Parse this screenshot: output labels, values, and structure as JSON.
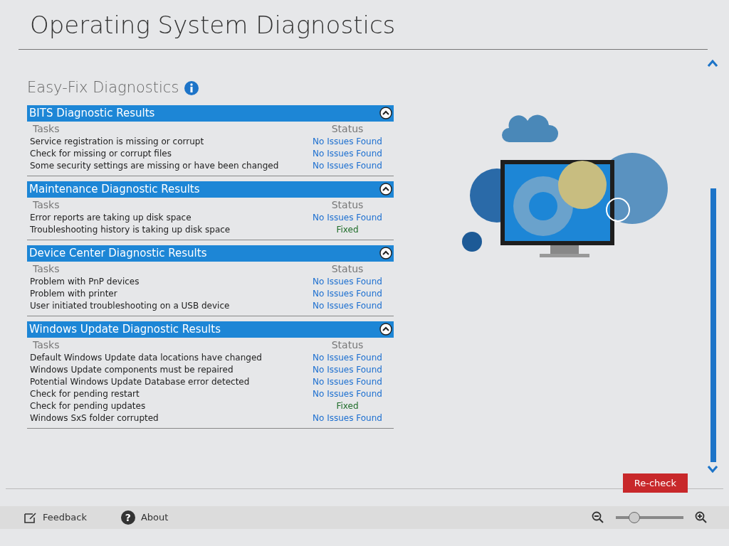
{
  "window": {
    "title": "Operating System Diagnostics"
  },
  "heading": "Easy-Fix Diagnostics",
  "sections": [
    {
      "title": "BITS Diagnostic Results",
      "expanded": true,
      "tasks_label": "Tasks",
      "status_label": "Status",
      "rows": [
        {
          "task": "Service registration is missing or corrupt",
          "status": "No Issues Found",
          "kind": "ok"
        },
        {
          "task": "Check for missing or corrupt files",
          "status": "No Issues Found",
          "kind": "ok"
        },
        {
          "task": "Some security settings are missing or have been changed",
          "status": "No Issues Found",
          "kind": "ok"
        }
      ]
    },
    {
      "title": "Maintenance Diagnostic Results",
      "expanded": true,
      "tasks_label": "Tasks",
      "status_label": "Status",
      "rows": [
        {
          "task": "Error reports are taking up disk space",
          "status": "No Issues Found",
          "kind": "ok"
        },
        {
          "task": "Troubleshooting history is taking up disk space",
          "status": "Fixed",
          "kind": "fixed"
        }
      ]
    },
    {
      "title": "Device Center Diagnostic Results",
      "expanded": true,
      "tasks_label": "Tasks",
      "status_label": "Status",
      "rows": [
        {
          "task": "Problem with PnP devices",
          "status": "No Issues Found",
          "kind": "ok"
        },
        {
          "task": "Problem with printer",
          "status": "No Issues Found",
          "kind": "ok"
        },
        {
          "task": "User initiated troubleshooting on a USB device",
          "status": "No Issues Found",
          "kind": "ok"
        }
      ]
    },
    {
      "title": "Windows Update Diagnostic Results",
      "expanded": true,
      "tasks_label": "Tasks",
      "status_label": "Status",
      "rows": [
        {
          "task": "Default Windows Update data locations have changed",
          "status": "No Issues Found",
          "kind": "ok"
        },
        {
          "task": "Windows Update components must be repaired",
          "status": "No Issues Found",
          "kind": "ok"
        },
        {
          "task": "Potential Windows Update Database error detected",
          "status": "No Issues Found",
          "kind": "ok"
        },
        {
          "task": "Check for pending restart",
          "status": "No Issues Found",
          "kind": "ok"
        },
        {
          "task": "Check for pending updates",
          "status": "Fixed",
          "kind": "fixed"
        },
        {
          "task": "Windows SxS folder corrupted",
          "status": "No Issues Found",
          "kind": "ok"
        }
      ]
    }
  ],
  "recheck_button": "Re-check",
  "footer": {
    "feedback": "Feedback",
    "about": "About",
    "about_icon": "?",
    "zoom": {
      "level": 0.27
    }
  }
}
